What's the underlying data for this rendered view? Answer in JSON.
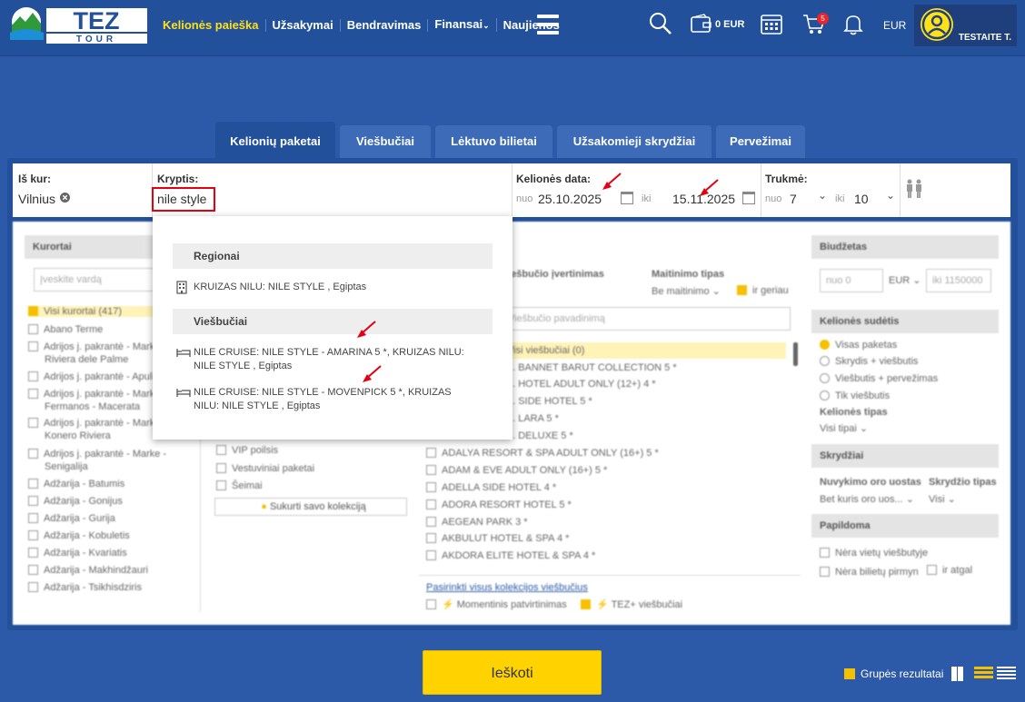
{
  "brand": {
    "logo_text": "TEZ",
    "logo_sub": "TOUR",
    "accent": "#ffe11a",
    "nav_bg": "#22509a"
  },
  "nav": {
    "items": [
      "Kelionės paieška",
      "Užsakymai",
      "Bendravimas",
      "Finansai",
      "Naujienos"
    ],
    "wallet": "0 EUR",
    "cart_count": "5",
    "currency": "EUR",
    "user": "TESTAITE T."
  },
  "tabs": [
    "Kelionių paketai",
    "Viešbučiai",
    "Lėktuvo bilietai",
    "Užsakomieji skrydžiai",
    "Pervežimai"
  ],
  "search": {
    "from_label": "Iš kur:",
    "from_value": "Vilnius",
    "dest_label": "Kryptis:",
    "dest_value": "nile style",
    "date_label": "Kelionės data:",
    "date_from_prefix": "nuo",
    "date_from": "25.10.2025",
    "date_to_prefix": "iki",
    "date_to": "15.11.2025",
    "dur_label": "Trukmė:",
    "dur_from_prefix": "nuo",
    "dur_from": "7",
    "dur_to_prefix": "iki",
    "dur_to": "10"
  },
  "dropdown": {
    "regions_header": "Regionai",
    "region_item": "KRUIZAS NILU: NILE STYLE , Egiptas",
    "hotels_header": "Viešbučiai",
    "hotel_1_line1": "NILE CRUISE: NILE STYLE - AMARINA 5 *, KRUIZAS NILU:",
    "hotel_1_line2": "NILE STYLE , Egiptas",
    "hotel_2_line1": "NILE CRUISE: NILE STYLE - MOVENPICK 5 *, KRUIZAS",
    "hotel_2_line2": "NILU: NILE STYLE , Egiptas"
  },
  "filters": {
    "resorts_header": "Kurortai",
    "resorts_placeholder": "Įveskite vardą",
    "resorts": [
      "Visi kurortai (417)",
      "Abano Terme",
      "Adrijos j. pakrantė - Marke,",
      "Riviera dele Palme",
      "Adrijos j. pakrantė - Apulija",
      "Adrijos j. pakrantė - Marke,",
      "Fermanos - Macerata",
      "Adrijos j. pakrantė - Marke,",
      "Konero Riviera",
      "Adrijos j. pakrantė - Marke -",
      "Senigalija",
      "Adžarija - Batumis",
      "Adžarija - Gonijus",
      "Adžarija - Gurija",
      "Adžarija - Kobuletis",
      "Adžarija - Kvariatis",
      "Adžarija - Makhindžauri",
      "Adžarija - Tsikhisdziris"
    ],
    "mid_col": [
      "VIP poilsis",
      "Vestuviniai paketai",
      "Šeimai"
    ],
    "collection_btn": "Sukurti savo kolekciją",
    "rating_header": "Viešbučio įvertinimas",
    "meal_header": "Maitinimo tipas",
    "meal_value": "Be maitinimo",
    "meal_better": "ir geriau",
    "hotel_search": "Viešbučio pavadinimą",
    "hotels": [
      "Visi viešbučiai (0)",
      "... BANNET BARUT COLLECTION 5 *",
      "... HOTEL ADULT ONLY (12+) 4 *",
      "... SIDE HOTEL 5 *",
      "... LARA 5 *",
      "... DELUXE 5 *",
      "ADALYA RESORT & SPA ADULT ONLY (16+) 5 *",
      "ADAM & EVE ADULT ONLY (16+) 5 *",
      "ADELLA SIDE HOTEL 4 *",
      "ADORA RESORT HOTEL 5 *",
      "AEGEAN PARK 3 *",
      "AKBULUT HOTEL & SPA 4 *",
      "AKDORA ELITE HOTEL & SPA 4 *"
    ],
    "collection_link": "Pasirinkti visus kolekcijos viešbučius",
    "instant": "Momentinis patvirtinimas",
    "tezplus": "TEZ+ viešbučiai",
    "budget_header": "Biudžetas",
    "budget_from": "nuo 0",
    "budget_cur": "EUR",
    "budget_to": "iki 1150000",
    "composition_header": "Kelionės sudėtis",
    "composition": [
      "Visas paketas",
      "Skrydis + viešbutis",
      "Viešbutis + pervežimas",
      "Tik viešbutis"
    ],
    "trip_type_label": "Kelionės tipas",
    "trip_type_value": "Visi tipai",
    "flights_header": "Skrydžiai",
    "airport_label": "Nuvykimo oro uostas",
    "airport_value": "Bet kuris oro uos...",
    "flight_type_label": "Skrydžio tipas",
    "flight_type_value": "Visi",
    "extra_header": "Papildoma",
    "extra": [
      "Nėra vietų viešbutyje",
      "Nėra bilietų pirmyn",
      "ir atgal"
    ]
  },
  "actions": {
    "search_btn": "Ieškoti",
    "group_results": "Grupės rezultatai"
  }
}
